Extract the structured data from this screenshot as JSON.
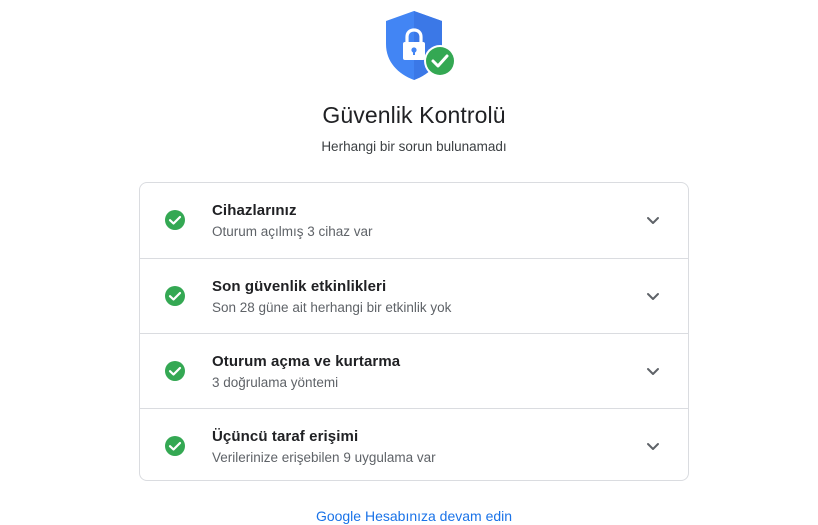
{
  "header": {
    "title": "Güvenlik Kontrolü",
    "subtitle": "Herhangi bir sorun bulunamadı",
    "icon": "shield-lock-check-icon"
  },
  "items": [
    {
      "title": "Cihazlarınız",
      "subtitle": "Oturum açılmış 3 cihaz var",
      "status": "ok"
    },
    {
      "title": "Son güvenlik etkinlikleri",
      "subtitle": "Son 28 güne ait herhangi bir etkinlik yok",
      "status": "ok"
    },
    {
      "title": "Oturum açma ve kurtarma",
      "subtitle": "3 doğrulama yöntemi",
      "status": "ok"
    },
    {
      "title": "Üçüncü taraf erişimi",
      "subtitle": "Verilerinize erişebilen 9 uygulama var",
      "status": "ok"
    }
  ],
  "footer": {
    "link_label": "Google Hesabınıza devam edin"
  },
  "colors": {
    "shield_blue": "#4285f4",
    "shield_dark": "#3367d6",
    "check_green": "#34a853",
    "link_blue": "#1a73e8",
    "border": "#dadce0"
  }
}
